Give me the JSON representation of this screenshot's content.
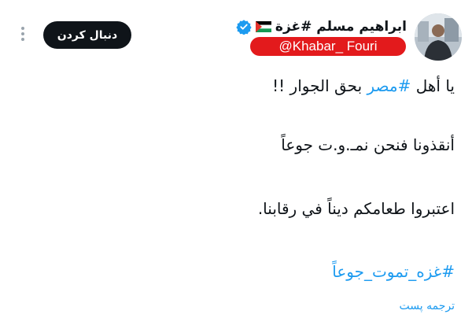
{
  "header": {
    "follow_label": "دنبال کردن",
    "author_name": "ابراهیم مسلم #غزة",
    "handle": "@Khabar_ Fouri",
    "icons": {
      "more": "more-dots-icon",
      "verified": "verified-badge-icon",
      "flag": "palestine-flag-icon"
    }
  },
  "tweet": {
    "line1_prefix": "يا أهل ",
    "line1_hashtag": "#مصر",
    "line1_suffix": " بحق الجوار !!",
    "line2": "أنقذونا فنحن نمـ.و.ت جوعاً",
    "line3": "اعتبروا طعامكم ديناً في رقابنا.",
    "line4_hashtag": "#غزه_تموت_جوعاً"
  },
  "footer": {
    "translate_label": "ترجمه پست"
  },
  "colors": {
    "link": "#1d9bf0",
    "follow_bg": "#0f1419",
    "handle_bg": "#e31a1c",
    "verified": "#1d9bf0"
  }
}
